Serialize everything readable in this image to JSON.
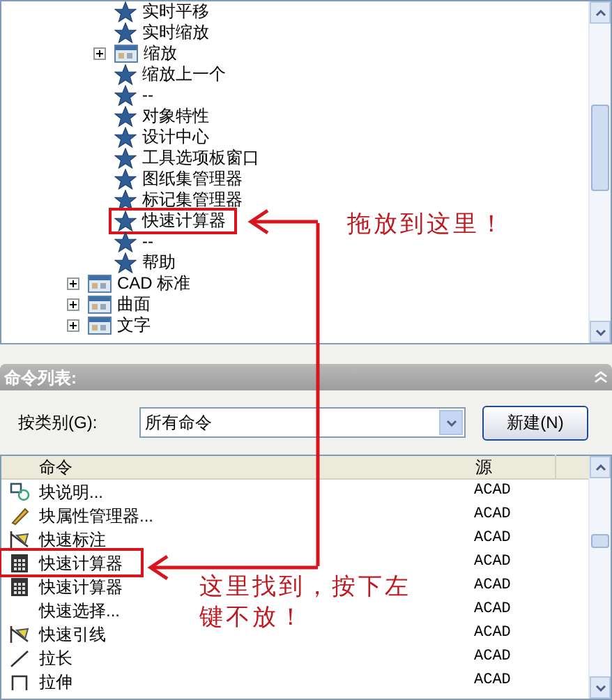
{
  "tree": {
    "items": [
      {
        "kind": "group",
        "children": [
          {
            "kind": "command",
            "label": "实时平移",
            "marked": false
          },
          {
            "kind": "command",
            "label": "实时缩放",
            "marked": false
          },
          {
            "kind": "menu",
            "label": "缩放",
            "expanded": false,
            "marked": false
          },
          {
            "kind": "command",
            "label": "缩放上一个",
            "marked": false
          },
          {
            "kind": "command",
            "label": "--",
            "marked": false
          },
          {
            "kind": "command",
            "label": "对象特性",
            "marked": false
          },
          {
            "kind": "command",
            "label": "设计中心",
            "marked": false
          },
          {
            "kind": "command",
            "label": "工具选项板窗口",
            "marked": false
          },
          {
            "kind": "command",
            "label": "图纸集管理器",
            "marked": false
          },
          {
            "kind": "command",
            "label": "标记集管理器",
            "marked": false
          },
          {
            "kind": "command",
            "label": "快速计算器",
            "marked": true
          },
          {
            "kind": "command",
            "label": "--",
            "marked": false
          },
          {
            "kind": "command",
            "label": "帮助",
            "marked": false
          }
        ]
      },
      {
        "kind": "menu",
        "label": "CAD 标准",
        "expanded": false,
        "marked": false
      },
      {
        "kind": "menu",
        "label": "曲面",
        "expanded": false,
        "marked": false
      },
      {
        "kind": "menu",
        "label": "文字",
        "expanded": false,
        "marked": false
      }
    ]
  },
  "command_list": {
    "title": "命令列表:",
    "category_label": "按类别(G):",
    "category_value": "所有命令",
    "new_button": "新建(N)",
    "columns": [
      "命令",
      "源"
    ],
    "rows": [
      {
        "kind": "block",
        "command": "块说明...",
        "source": "ACAD",
        "marked": false
      },
      {
        "kind": "pen",
        "command": "块属性管理器...",
        "source": "ACAD",
        "marked": false
      },
      {
        "kind": "dim",
        "command": "快速标注",
        "source": "ACAD",
        "marked": false
      },
      {
        "kind": "calc",
        "command": "快速计算器",
        "source": "ACAD",
        "marked": true
      },
      {
        "kind": "calc",
        "command": "快速计算器",
        "source": "ACAD",
        "marked": false
      },
      {
        "kind": "none",
        "command": "快速选择...",
        "source": "ACAD",
        "marked": false
      },
      {
        "kind": "dim",
        "command": "快速引线",
        "source": "ACAD",
        "marked": false
      },
      {
        "kind": "line",
        "command": "拉长",
        "source": "ACAD",
        "marked": false
      },
      {
        "kind": "stretch",
        "command": "拉伸",
        "source": "ACAD",
        "marked": false
      }
    ]
  },
  "annotations": {
    "drop_note": "拖放到这里！",
    "find_note": "这里找到，按下左键不放！"
  }
}
